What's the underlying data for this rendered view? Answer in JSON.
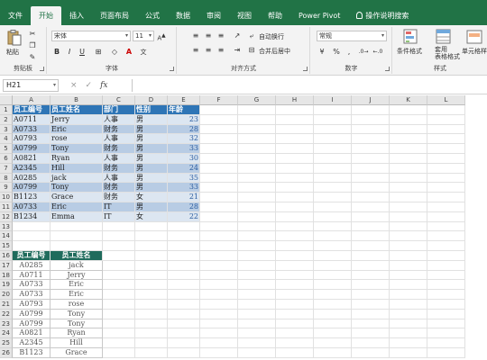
{
  "ribbon_tabs": [
    {
      "label": "文件",
      "active": false
    },
    {
      "label": "开始",
      "active": true
    },
    {
      "label": "插入",
      "active": false
    },
    {
      "label": "页面布局",
      "active": false
    },
    {
      "label": "公式",
      "active": false
    },
    {
      "label": "数据",
      "active": false
    },
    {
      "label": "审阅",
      "active": false
    },
    {
      "label": "视图",
      "active": false
    },
    {
      "label": "帮助",
      "active": false
    },
    {
      "label": "Power Pivot",
      "active": false
    },
    {
      "label": "操作说明搜索",
      "active": false
    }
  ],
  "ribbon": {
    "paste_label": "粘贴",
    "clipboard_label": "剪贴板",
    "font_name": "宋体",
    "font_size": "11",
    "bold": "B",
    "italic": "I",
    "underline": "U",
    "font_label": "字体",
    "wrap_text": "自动换行",
    "merge_center": "合并后居中",
    "align_label": "对齐方式",
    "number_format": "常规",
    "pct": "%",
    "comma": ",",
    "number_label": "数字",
    "conditional_format": "条件格式",
    "format_table": "套用\n表格格式",
    "cell_styles": "单元格样",
    "styles_label": "样式",
    "colors": {
      "brand": "#217346",
      "header_blue": "#2e75b6",
      "band_light": "#dce6f1",
      "band_dark": "#b8cce4",
      "header_teal": "#1f6b5c"
    }
  },
  "formula_bar": {
    "name_box": "H21",
    "cancel": "×",
    "confirm": "✓",
    "fx": "fx",
    "content": ""
  },
  "columns": [
    "A",
    "B",
    "C",
    "D",
    "E",
    "F",
    "G",
    "H",
    "I",
    "J",
    "K",
    "L"
  ],
  "rows": [
    "1",
    "2",
    "3",
    "4",
    "5",
    "6",
    "7",
    "8",
    "9",
    "10",
    "11",
    "12",
    "13",
    "14",
    "15",
    "16",
    "17",
    "18",
    "19",
    "20",
    "21",
    "22",
    "23",
    "24",
    "25",
    "26"
  ],
  "table1": {
    "headers": [
      "员工编号",
      "员工姓名",
      "部门",
      "性别",
      "年龄"
    ],
    "rows": [
      [
        "A0711",
        "Jerry",
        "人事",
        "男",
        "23"
      ],
      [
        "A0733",
        "Eric",
        "财务",
        "男",
        "28"
      ],
      [
        "A0793",
        "rose",
        "人事",
        "男",
        "32"
      ],
      [
        "A0799",
        "Tony",
        "财务",
        "男",
        "33"
      ],
      [
        "A0821",
        "Ryan",
        "人事",
        "男",
        "30"
      ],
      [
        "A2345",
        "Hill",
        "财务",
        "男",
        "24"
      ],
      [
        "A0285",
        "jack",
        "人事",
        "男",
        "35"
      ],
      [
        "A0799",
        "Tony",
        "财务",
        "男",
        "33"
      ],
      [
        "B1123",
        "Grace",
        "财务",
        "女",
        "21"
      ],
      [
        "A0733",
        "Eric",
        "IT",
        "男",
        "28"
      ],
      [
        "B1234",
        "Emma",
        "IT",
        "女",
        "22"
      ]
    ]
  },
  "table2": {
    "headers": [
      "员工编号",
      "员工姓名"
    ],
    "rows": [
      [
        "A0285",
        "jack"
      ],
      [
        "A0711",
        "Jerry"
      ],
      [
        "A0733",
        "Eric"
      ],
      [
        "A0733",
        "Eric"
      ],
      [
        "A0793",
        "rose"
      ],
      [
        "A0799",
        "Tony"
      ],
      [
        "A0799",
        "Tony"
      ],
      [
        "A0821",
        "Ryan"
      ],
      [
        "A2345",
        "Hill"
      ],
      [
        "B1123",
        "Grace"
      ]
    ]
  }
}
